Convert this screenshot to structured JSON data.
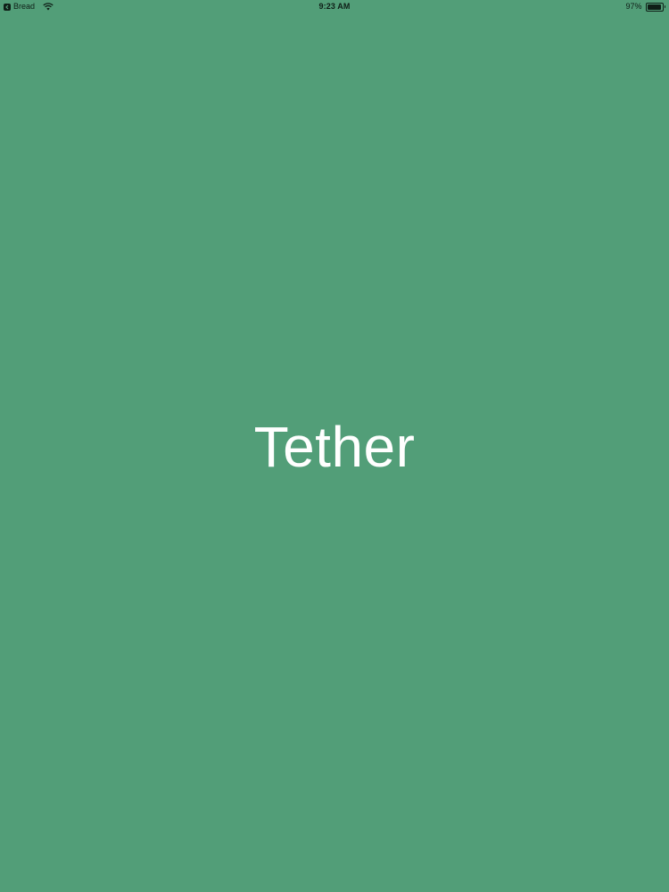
{
  "status_bar": {
    "back_app_label": "Bread",
    "time": "9:23 AM",
    "battery_percent_label": "97%",
    "battery_level": 0.97
  },
  "splash": {
    "title": "Tether"
  },
  "colors": {
    "background": "#529E78",
    "title_text": "#FFFFFF",
    "status_text": "#0F1F17"
  },
  "icons": {
    "back_app": "back-to-app-icon",
    "wifi": "wifi-icon",
    "battery": "battery-icon"
  }
}
